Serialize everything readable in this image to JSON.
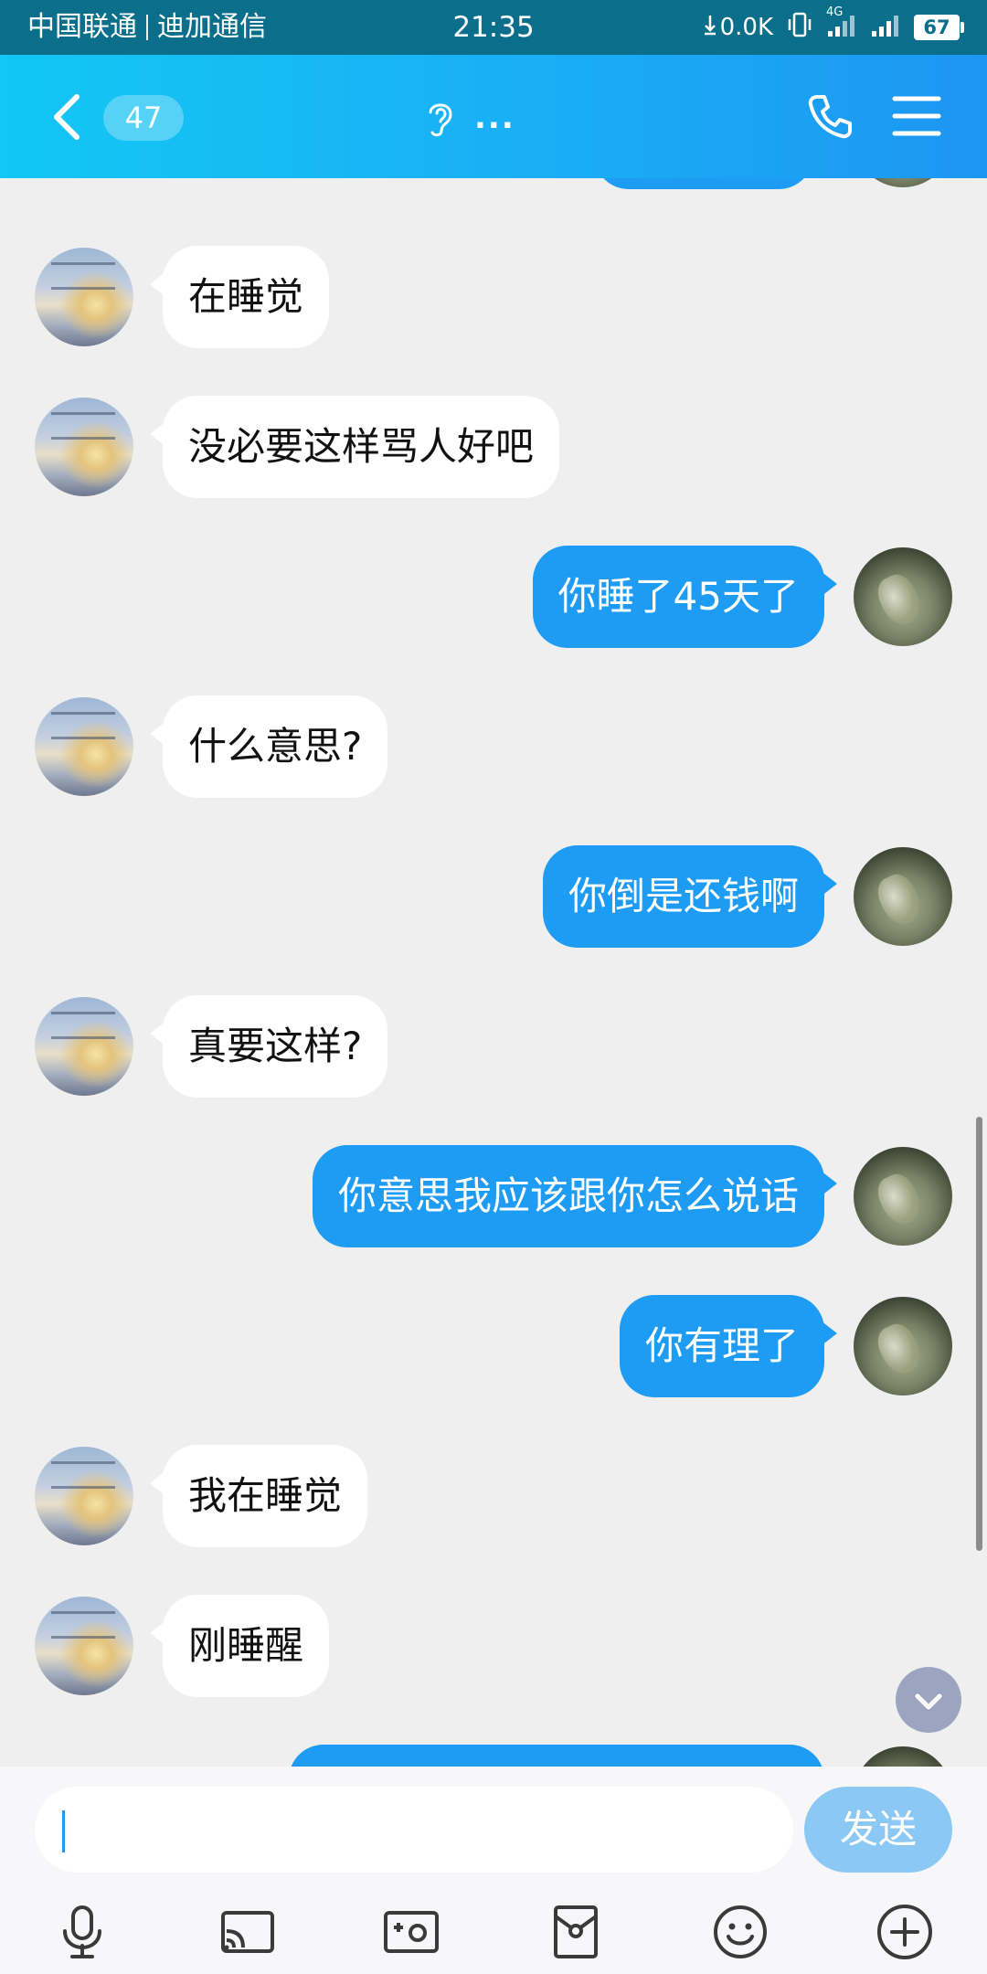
{
  "status_bar": {
    "carrier": "中国联通",
    "carrier2": "迪加通信",
    "time": "21:35",
    "net_speed": "0.0K",
    "network": "4G",
    "battery": "67"
  },
  "header": {
    "unread_count": "47",
    "title": "...",
    "icons": {
      "back": "back-arrow-icon",
      "ear": "ear-icon",
      "call": "phone-icon",
      "menu": "menu-icon"
    }
  },
  "messages": [
    {
      "side": "recv",
      "text": "在睡觉"
    },
    {
      "side": "recv",
      "text": "没必要这样骂人好吧"
    },
    {
      "side": "sent",
      "text": "你睡了45天了"
    },
    {
      "side": "recv",
      "text": "什么意思?"
    },
    {
      "side": "sent",
      "text": "你倒是还钱啊"
    },
    {
      "side": "recv",
      "text": "真要这样?"
    },
    {
      "side": "sent",
      "text": "你意思我应该跟你怎么说话"
    },
    {
      "side": "sent",
      "text": "你有理了"
    },
    {
      "side": "recv",
      "text": "我在睡觉"
    },
    {
      "side": "recv",
      "text": "刚睡醒"
    }
  ],
  "input": {
    "value": "",
    "placeholder": "",
    "send_label": "发送"
  },
  "toolbar": [
    "microphone-icon",
    "screen-cast-icon",
    "photo-icon",
    "red-packet-icon",
    "emoji-icon",
    "plus-icon"
  ],
  "colors": {
    "header_start": "#12c7f4",
    "header_end": "#1c96f2",
    "sent_bubble": "#1e9bf2",
    "recv_bubble": "#ffffff",
    "background": "#efefef",
    "send_button": "#8cc8f4"
  }
}
